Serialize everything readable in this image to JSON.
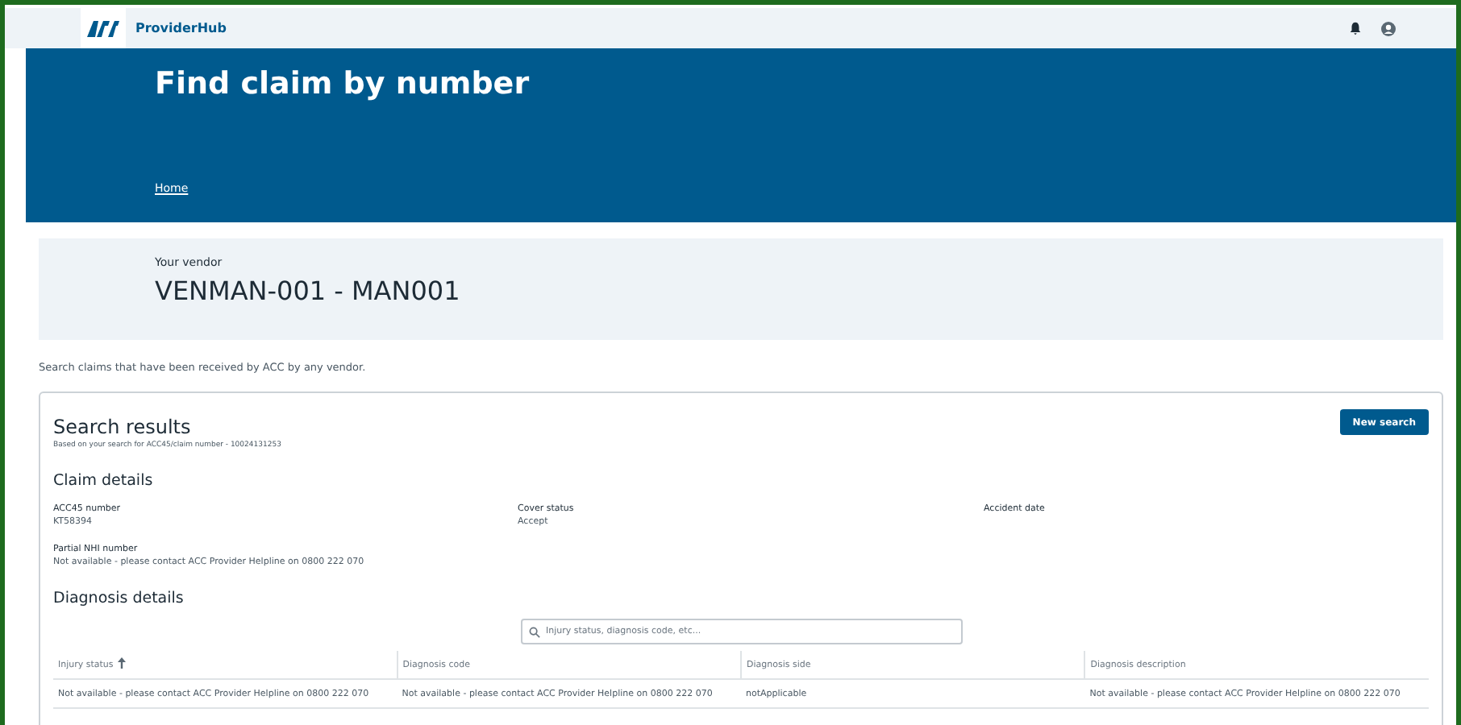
{
  "topbar": {
    "app_name": "ProviderHub"
  },
  "banner": {
    "title": "Find claim by number",
    "breadcrumb": "Home"
  },
  "vendor": {
    "label": "Your vendor",
    "value": "VENMAN-001 - MAN001"
  },
  "intro": "Search claims that have been received by ACC by any vendor.",
  "results": {
    "title": "Search results",
    "subtitle": "Based on your search for ACC45/claim number - 10024131253",
    "button": "New search",
    "claim_details": {
      "heading": "Claim details",
      "fields": [
        {
          "label": "ACC45 number",
          "value": "KT58394"
        },
        {
          "label": "Cover status",
          "value": "Accept"
        },
        {
          "label": "Accident date"
        },
        {
          "label": "Partial NHI number",
          "value": "Not available - please contact ACC Provider Helpline on 0800 222 070"
        }
      ]
    },
    "diagnosis": {
      "heading": "Diagnosis details",
      "search": {
        "placeholder": "Injury status, diagnosis code, etc..."
      },
      "columns": [
        {
          "label": "Injury status",
          "sorted": true
        },
        {
          "label": "Diagnosis code",
          "sorted": false
        },
        {
          "label": "Diagnosis side",
          "sorted": false
        },
        {
          "label": "Diagnosis description",
          "sorted": false
        }
      ],
      "rows": [
        [
          "Not available - please contact ACC Provider Helpline on 0800 222 070",
          "Not available - please contact ACC Provider Helpline on 0800 222 070",
          "notApplicable",
          "Not available - please contact ACC Provider Helpline on 0800 222 070"
        ]
      ]
    }
  }
}
